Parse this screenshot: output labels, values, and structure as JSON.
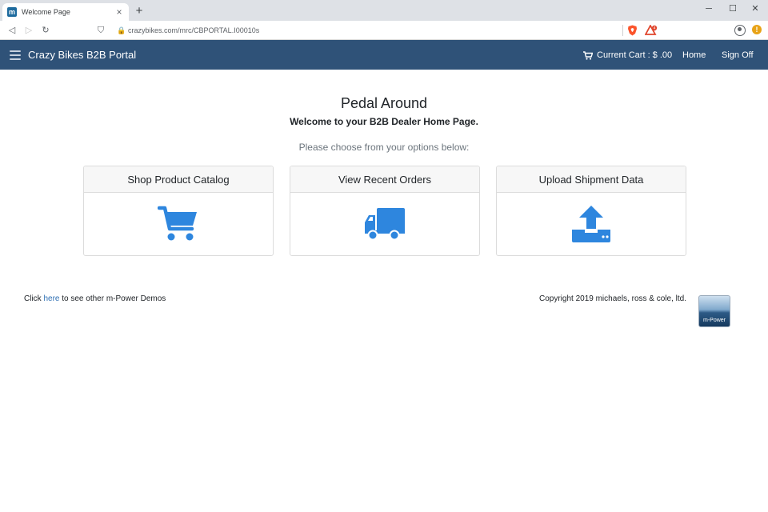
{
  "browser": {
    "tab_title": "Welcome Page",
    "favicon_letter": "m",
    "tab_close": "×",
    "new_tab": "+",
    "url": "crazybikes.com/mrc/CBPORTAL.I00010s",
    "window_controls": {
      "minimize": "─",
      "maximize": "☐",
      "close": "✕"
    },
    "nav": {
      "back": "◁",
      "forward": "▷",
      "reload": "↻",
      "bookmark": "⛉"
    },
    "lock_icon": "🔒",
    "alert_badge": "!",
    "colors": {
      "tabstrip": "#dee1e6",
      "brave": "#fb542b",
      "alert": "#e8a317"
    }
  },
  "navbar": {
    "brand": "Crazy Bikes B2B Portal",
    "cart": "Current Cart : $ .00",
    "home": "Home",
    "sign_off": "Sign Off",
    "color": "#2f5278"
  },
  "main": {
    "title": "Pedal Around",
    "welcome": "Welcome to your B2B Dealer Home Page.",
    "instructions": "Please choose from your options below:",
    "cards": [
      {
        "label": "Shop Product Catalog",
        "icon": "shopping-cart-icon"
      },
      {
        "label": "View Recent Orders",
        "icon": "truck-icon"
      },
      {
        "label": "Upload Shipment Data",
        "icon": "upload-icon"
      }
    ],
    "icon_color": "#2e86de"
  },
  "footer": {
    "demo_prefix": "Click ",
    "demo_link": "here",
    "demo_suffix": " to see other m-Power Demos",
    "copyright": "Copyright 2019 michaels, ross & cole, ltd.",
    "logo_text": "m-Power"
  }
}
